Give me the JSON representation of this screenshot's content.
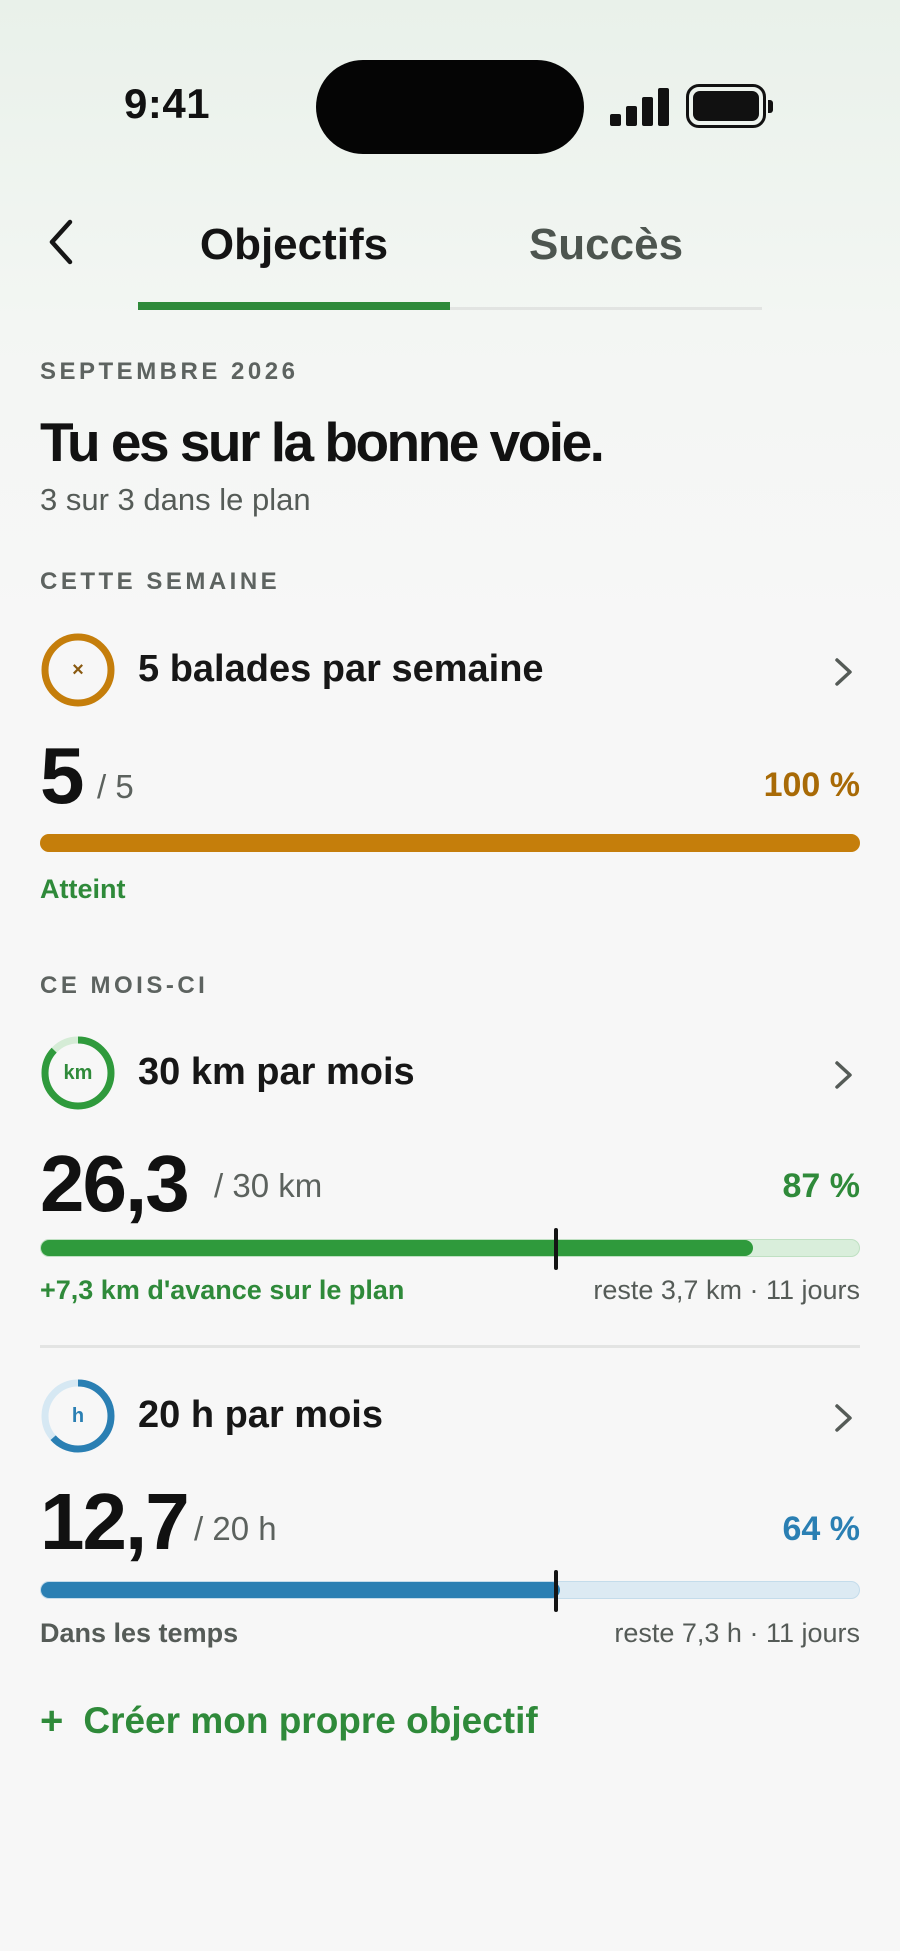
{
  "status_bar": {
    "time": "9:41"
  },
  "nav": {
    "tabs": [
      {
        "label": "Objectifs",
        "active": true
      },
      {
        "label": "Succès",
        "active": false
      }
    ]
  },
  "summary": {
    "period": "SEPTEMBRE 2026",
    "headline": "Tu es sur la bonne voie.",
    "subline": "3 sur 3 dans le plan"
  },
  "sections": [
    {
      "label": "CETTE SEMAINE",
      "goals": [
        {
          "ring_label": "×",
          "ring_color": "#c57e0b",
          "title": "5 balades par semaine",
          "value": "5",
          "target": "/ 5",
          "percent": "100 %",
          "progress": 1.0,
          "accent": "#c57e0b",
          "status": "Atteint",
          "status_color": "#2f8a3a",
          "remaining": ""
        }
      ]
    },
    {
      "label": "CE MOIS-CI",
      "goals": [
        {
          "ring_label": "km",
          "ring_color": "#2f9a3c",
          "title": "30 km par mois",
          "value": "26,3",
          "target": "/ 30 km",
          "percent": "87 %",
          "progress": 0.87,
          "plan_marker": 0.63,
          "accent": "#2f9a3c",
          "status": "+7,3 km d'avance sur le plan",
          "status_color": "#2f8a3a",
          "remaining": "reste 3,7 km · 11 jours"
        },
        {
          "ring_label": "h",
          "ring_color": "#2a7fb3",
          "title": "20 h par mois",
          "value": "12,7",
          "target": "/ 20 h",
          "percent": "64 %",
          "progress": 0.635,
          "plan_marker": 0.63,
          "accent": "#2a7fb3",
          "status": "Dans les temps",
          "status_color": "#555b57",
          "remaining": "reste 7,3 h · 11 jours"
        }
      ]
    }
  ],
  "create_goal": {
    "icon": "plus-icon",
    "label": "Créer mon propre objectif"
  }
}
